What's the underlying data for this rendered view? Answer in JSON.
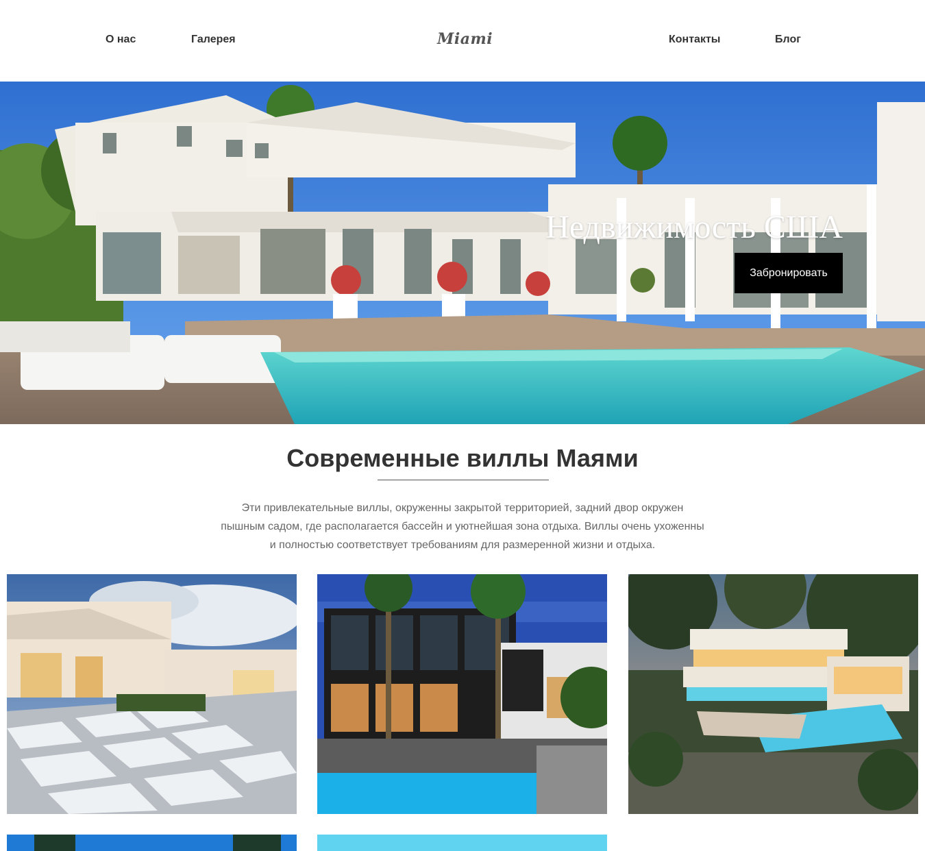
{
  "header": {
    "logo": "Miami",
    "nav_left": [
      "О нас",
      "Галерея"
    ],
    "nav_right": [
      "Контакты",
      "Блог"
    ]
  },
  "hero": {
    "title": "Недвижимость США",
    "button_label": "Забронировать"
  },
  "section": {
    "title": "Современные виллы Маями",
    "description": "Эти привлекательные виллы, окруженны закрытой территорией, задний двор окружен пышным садом, где располагается бассейн и уютнейшая зона отдыха. Виллы очень ухоженны и полностью соответствует требованиям для размеренной жизни и отдыха."
  },
  "gallery": {
    "items": [
      "villa-courtyard-photo",
      "modern-villa-pool-photo",
      "hillside-villa-photo",
      "palm-villa-photo",
      "sky-villa-photo"
    ]
  }
}
